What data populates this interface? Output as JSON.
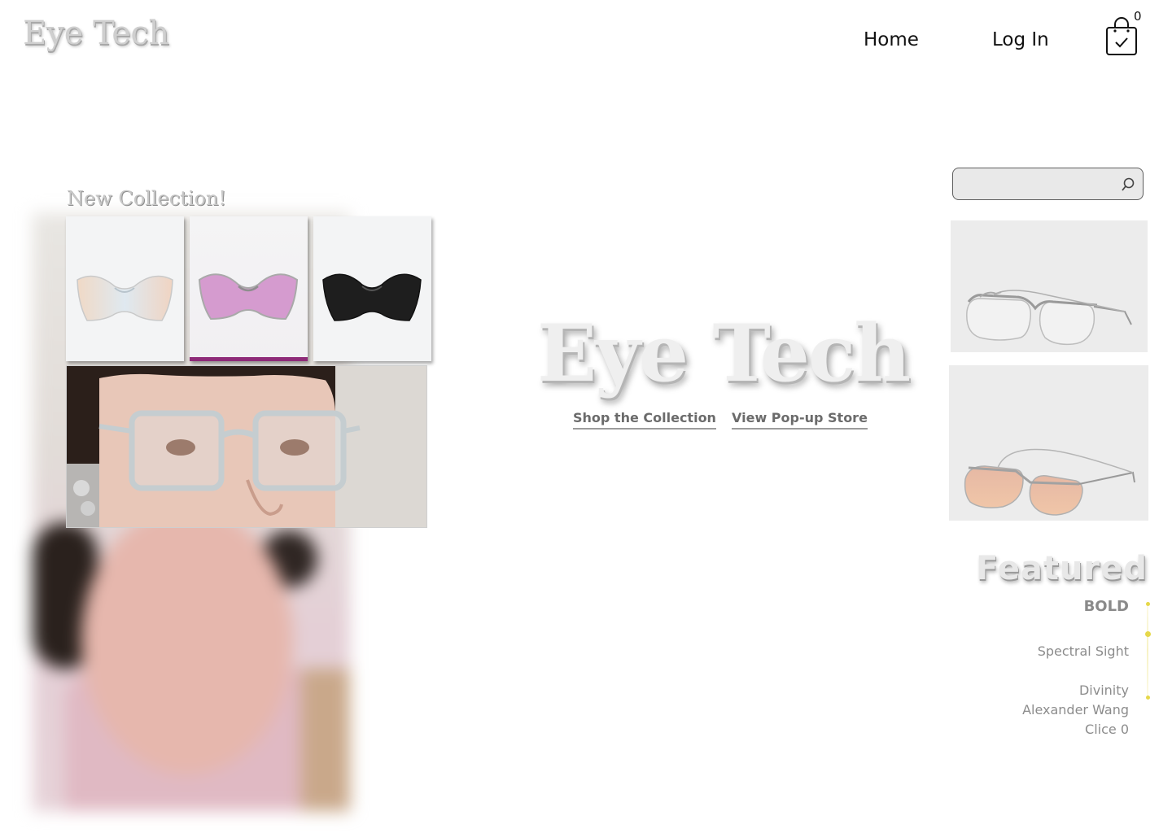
{
  "header": {
    "logo": "Eye Tech",
    "nav": [
      {
        "label": "Home"
      },
      {
        "label": "Log In"
      }
    ],
    "cart_count": "0"
  },
  "collection": {
    "heading": "New Collection!"
  },
  "hero": {
    "title": "Eye Tech",
    "links": [
      {
        "label": "Shop the Collection"
      },
      {
        "label": "View Pop-up Store"
      }
    ]
  },
  "search": {
    "value": "",
    "placeholder": ""
  },
  "featured": {
    "heading": "Featured",
    "items": [
      {
        "label": "BOLD",
        "active": true
      },
      {
        "label": "Spectral Sight"
      },
      {
        "label": "Divinity"
      },
      {
        "label": "Alexander Wang"
      },
      {
        "label": "Clice 0"
      }
    ]
  },
  "colors": {
    "accent_purple": "#8e2a78",
    "scroll_indicator": "#e6d84a",
    "text_dark": "#111111",
    "text_muted": "#8c8c8c"
  },
  "icons": {
    "cart": "shopping-bag-check-icon",
    "search": "magnifier-icon"
  }
}
